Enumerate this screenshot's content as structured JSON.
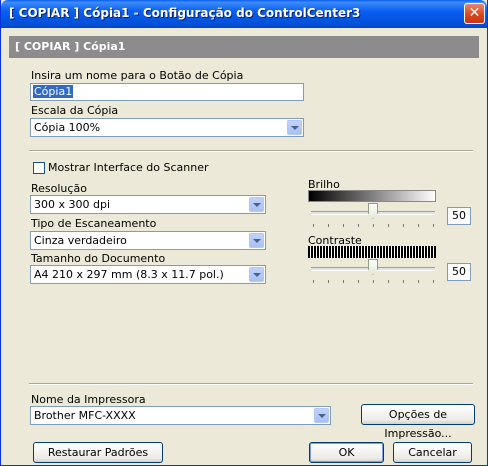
{
  "window": {
    "title": "[ COPIAR ]  Cópia1 - Configuração do ControlCenter3"
  },
  "header": {
    "text": "[ COPIAR ]  Cópia1"
  },
  "name_field": {
    "label": "Insira um nome para o Botão de Cópia",
    "value": "Cópia1"
  },
  "scale": {
    "label": "Escala da Cópia",
    "value": "Cópia 100%"
  },
  "scanner": {
    "show_interface_label": "Mostrar Interface do Scanner",
    "show_interface_checked": false,
    "resolution_label": "Resolução",
    "resolution_value": "300 x 300 dpi",
    "scan_type_label": "Tipo de Escaneamento",
    "scan_type_value": "Cinza verdadeiro",
    "doc_size_label": "Tamanho do Documento",
    "doc_size_value": "A4 210 x 297 mm (8.3 x 11.7 pol.)"
  },
  "brightness": {
    "label": "Brilho",
    "value": "50"
  },
  "contrast": {
    "label": "Contraste",
    "value": "50"
  },
  "printer": {
    "label": "Nome da Impressora",
    "value": "Brother MFC-XXXX",
    "options_button": "Opções de Impressão..."
  },
  "buttons": {
    "restore": "Restaurar Padrões",
    "ok": "OK",
    "cancel": "Cancelar"
  },
  "icons": {
    "close": "close-icon",
    "dropdown": "chevron-down-icon"
  }
}
